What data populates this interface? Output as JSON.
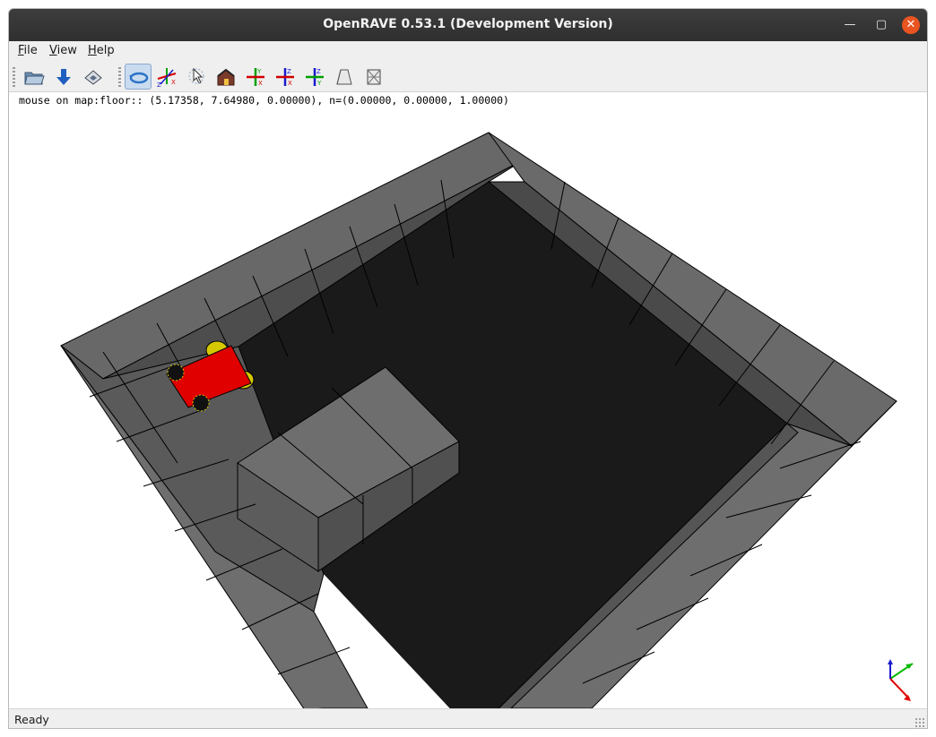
{
  "window": {
    "title": "OpenRAVE 0.53.1 (Development Version)"
  },
  "menu": {
    "file": {
      "mnemonic": "F",
      "rest": "ile"
    },
    "view": {
      "mnemonic": "V",
      "rest": "iew"
    },
    "help": {
      "mnemonic": "H",
      "rest": "elp"
    }
  },
  "toolbar": {
    "icons": [
      "open-folder-icon",
      "download-arrow-icon",
      "save-disk-icon",
      "rotate-view-icon",
      "axes-xyz-icon",
      "pointer-select-icon",
      "home-icon",
      "axes-yx-icon",
      "axes-zx-icon",
      "axes-zy-icon",
      "perspective-frustum-icon",
      "orthographic-box-icon"
    ],
    "active_tool": "rotate-view-icon"
  },
  "viewport": {
    "mouse_readout": "mouse on map:floor:: (5.17358, 7.64980, 0.00000), n=(0.00000, 0.00000, 1.00000)",
    "colors": {
      "floor": "#1a1a1a",
      "block_top": "#6e6e6e",
      "robot_body": "#e00000",
      "robot_wheel": "#d6c800",
      "axis_x": "#e00000",
      "axis_y": "#00b800",
      "axis_z": "#1a1acc"
    }
  },
  "status": {
    "text": "Ready"
  }
}
